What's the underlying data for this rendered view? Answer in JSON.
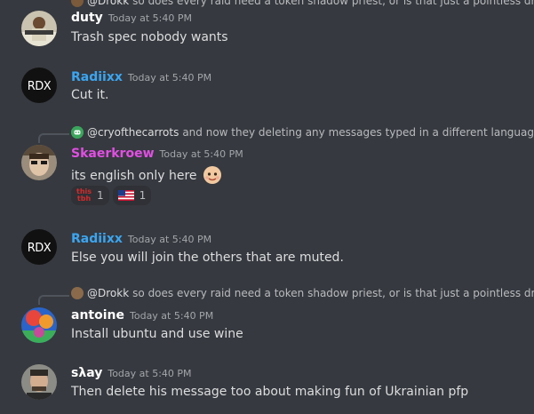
{
  "top_reply": {
    "author": "@Drokk",
    "text": "so does every raid need a token shadow priest, or is that just a pointless dream"
  },
  "messages": [
    {
      "username": "duty",
      "username_color": "#ffffff",
      "timestamp": "Today at 5:40 PM",
      "content": "Trash spec nobody wants"
    },
    {
      "username": "Radiixx",
      "username_color": "#3ba5f0",
      "avatar_text": "RDX",
      "timestamp": "Today at 5:40 PM",
      "content": "Cut it."
    },
    {
      "reply": {
        "author": "@cryofthecarrots",
        "text": "and now they deleting any messages typed in a different language? y"
      },
      "username": "Skaerkroew",
      "username_color": "#e14fe3",
      "timestamp": "Today at 5:40 PM",
      "content": "its english only here",
      "reactions": [
        {
          "emoji": "this-tbh",
          "emoji_text_top": "this",
          "emoji_text_bottom": "tbh",
          "count": "1"
        },
        {
          "emoji": "us-flag-icon",
          "count": "1"
        }
      ]
    },
    {
      "username": "Radiixx",
      "username_color": "#3ba5f0",
      "avatar_text": "RDX",
      "timestamp": "Today at 5:40 PM",
      "content": "Else you will join the others that are muted."
    },
    {
      "reply": {
        "author": "@Drokk",
        "text": "so does every raid need a token shadow priest, or is that just a pointless dream"
      },
      "username": "antoine",
      "username_color": "#ffffff",
      "timestamp": "Today at 5:40 PM",
      "content": "Install ubuntu and use wine"
    },
    {
      "username": "sλay",
      "username_color": "#ffffff",
      "timestamp": "Today at 5:40 PM",
      "content": "Then delete his message too about making fun of Ukrainian pfp"
    }
  ]
}
